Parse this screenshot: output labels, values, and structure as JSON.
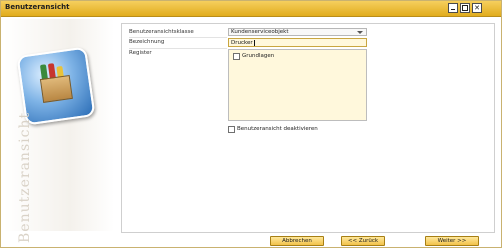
{
  "window": {
    "title": "Benutzeransicht"
  },
  "sidebar": {
    "vertical_text": "Benutzeransicht",
    "icon": "box-with-bottles-icon"
  },
  "form": {
    "class_label": "Benutzeransichtsklasse",
    "class_value": "Kundenserviceobjekt",
    "name_label": "Bezeichnung",
    "name_value": "Drucker",
    "register_label": "Register",
    "register_items": [
      {
        "label": "Grundlagen",
        "checked": false
      }
    ],
    "deactivate_label": "Benutzeransicht deaktivieren",
    "deactivate_checked": false
  },
  "buttons": {
    "cancel_label": "Abbrechen",
    "back_label": "<< Zurück",
    "next_label": "Weiter >>"
  },
  "colors": {
    "titlebar": "#e8b52a",
    "field_highlight": "#fff8dc",
    "button": "#f2c24a"
  }
}
